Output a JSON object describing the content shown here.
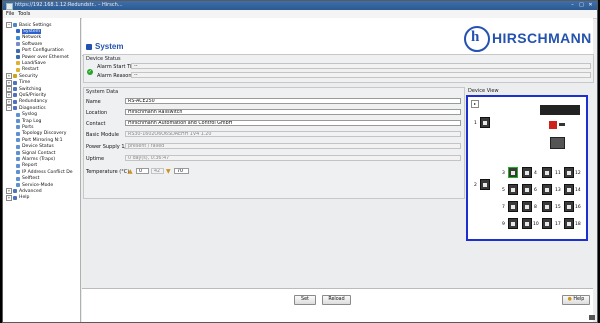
{
  "window": {
    "title": "https://192.168.1.12:Redundstr.. – Hirsch..."
  },
  "menubar": {
    "items": [
      "File",
      "Tools"
    ]
  },
  "tree": [
    {
      "label": "Basic Settings",
      "level": 0,
      "expanded": true,
      "color": "#4a86c8"
    },
    {
      "label": "System",
      "level": 1,
      "selected": true,
      "color": "#2f62c8"
    },
    {
      "label": "Network",
      "level": 1,
      "color": "#3a8ad0"
    },
    {
      "label": "Software",
      "level": 1,
      "color": "#7a8ad0"
    },
    {
      "label": "Port Configuration",
      "level": 1,
      "color": "#3a6ab0"
    },
    {
      "label": "Power over Ethernet",
      "level": 1,
      "color": "#3a6ab0"
    },
    {
      "label": "Load/Save",
      "level": 1,
      "color": "#e0b030"
    },
    {
      "label": "Restart",
      "level": 1,
      "color": "#e0b030"
    },
    {
      "label": "Security",
      "level": 0,
      "color": "#d0a020"
    },
    {
      "label": "Time",
      "level": 0,
      "color": "#5070c0"
    },
    {
      "label": "Switching",
      "level": 0,
      "color": "#5070c0"
    },
    {
      "label": "QoS/Priority",
      "level": 0,
      "color": "#5070c0"
    },
    {
      "label": "Redundancy",
      "level": 0,
      "color": "#5070c0"
    },
    {
      "label": "Diagnostics",
      "level": 0,
      "expanded": true,
      "color": "#5070c0"
    },
    {
      "label": "Syslog",
      "level": 1,
      "color": "#6090d0"
    },
    {
      "label": "Trap Log",
      "level": 1,
      "color": "#6090d0"
    },
    {
      "label": "Ports",
      "level": 1,
      "color": "#6090d0"
    },
    {
      "label": "Topology Discovery",
      "level": 1,
      "color": "#6090d0"
    },
    {
      "label": "Port Mirroring N:1",
      "level": 1,
      "color": "#6090d0"
    },
    {
      "label": "Device Status",
      "level": 1,
      "color": "#6090d0"
    },
    {
      "label": "Signal Contact",
      "level": 1,
      "color": "#6090d0"
    },
    {
      "label": "Alarms (Traps)",
      "level": 1,
      "color": "#6090d0"
    },
    {
      "label": "Report",
      "level": 1,
      "color": "#6090d0"
    },
    {
      "label": "IP Address Conflict De",
      "level": 1,
      "color": "#6090d0"
    },
    {
      "label": "Selftest",
      "level": 1,
      "color": "#6090d0"
    },
    {
      "label": "Service-Mode",
      "level": 1,
      "color": "#6090d0"
    },
    {
      "label": "Advanced",
      "level": 0,
      "color": "#5070c0"
    },
    {
      "label": "Help",
      "level": 0,
      "color": "#5070c0"
    }
  ],
  "header": {
    "page_title": "System",
    "brand": "HIRSCHMANN",
    "logo_letter": "h"
  },
  "device_status": {
    "title": "Device Status",
    "alarm_start_label": "Alarm Start Time",
    "alarm_start_value": "--",
    "alarm_reason_label": "Alarm Reason",
    "alarm_reason_value": "--"
  },
  "system_data": {
    "title": "System Data",
    "name_label": "Name",
    "name_value": "RS-ACE250",
    "location_label": "Location",
    "location_value": "Hirschmann Railswitch",
    "contact_label": "Contact",
    "contact_value": "Hirschmann Automation and Control GmbH",
    "module_label": "Basic Module",
    "module_value": "RS30-1602O6O6SDAEHH 1V4 1.20",
    "power_label": "Power Supply 1/2",
    "power_value": "present / failed",
    "uptime_label": "Uptime",
    "uptime_value": "0 day(s), 0:36:47",
    "temp_label": "Temperature (°C)",
    "temp_min": "0",
    "temp_cur": "42",
    "temp_max": "70"
  },
  "device_view": {
    "title": "Device View",
    "port_labels_left": [
      "1",
      "2"
    ],
    "port_labels_grid": [
      "3",
      "4",
      "11",
      "12",
      "5",
      "6",
      "13",
      "14",
      "7",
      "8",
      "15",
      "16",
      "9",
      "10",
      "17",
      "18"
    ]
  },
  "footer": {
    "set": "Set",
    "reload": "Reload",
    "help": "Help"
  }
}
